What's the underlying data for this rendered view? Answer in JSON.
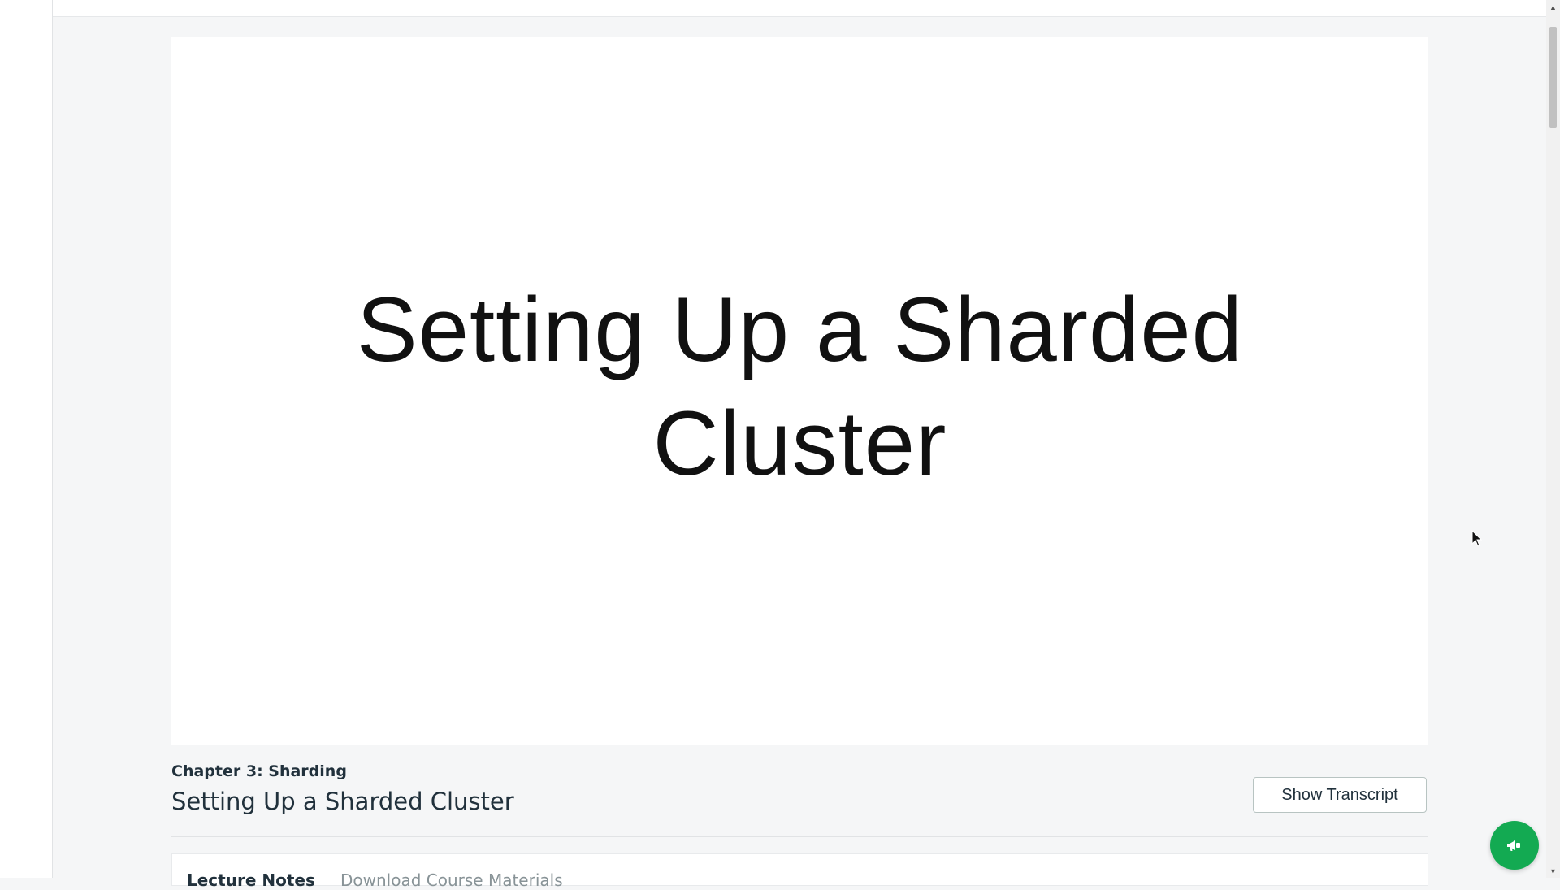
{
  "player": {
    "slide_title": "Setting Up a Sharded Cluster"
  },
  "lesson": {
    "chapter": "Chapter 3: Sharding",
    "title": "Setting Up a Sharded Cluster",
    "show_transcript_label": "Show Transcript"
  },
  "tabs": {
    "notes_label": "Lecture Notes",
    "download_label": "Download Course Materials"
  },
  "icons": {
    "feedback": "megaphone-icon",
    "scroll_up": "arrow-up-icon",
    "scroll_down": "arrow-down-icon"
  },
  "colors": {
    "accent": "#13aa52",
    "text": "#21313c",
    "background": "#f5f6f7"
  }
}
